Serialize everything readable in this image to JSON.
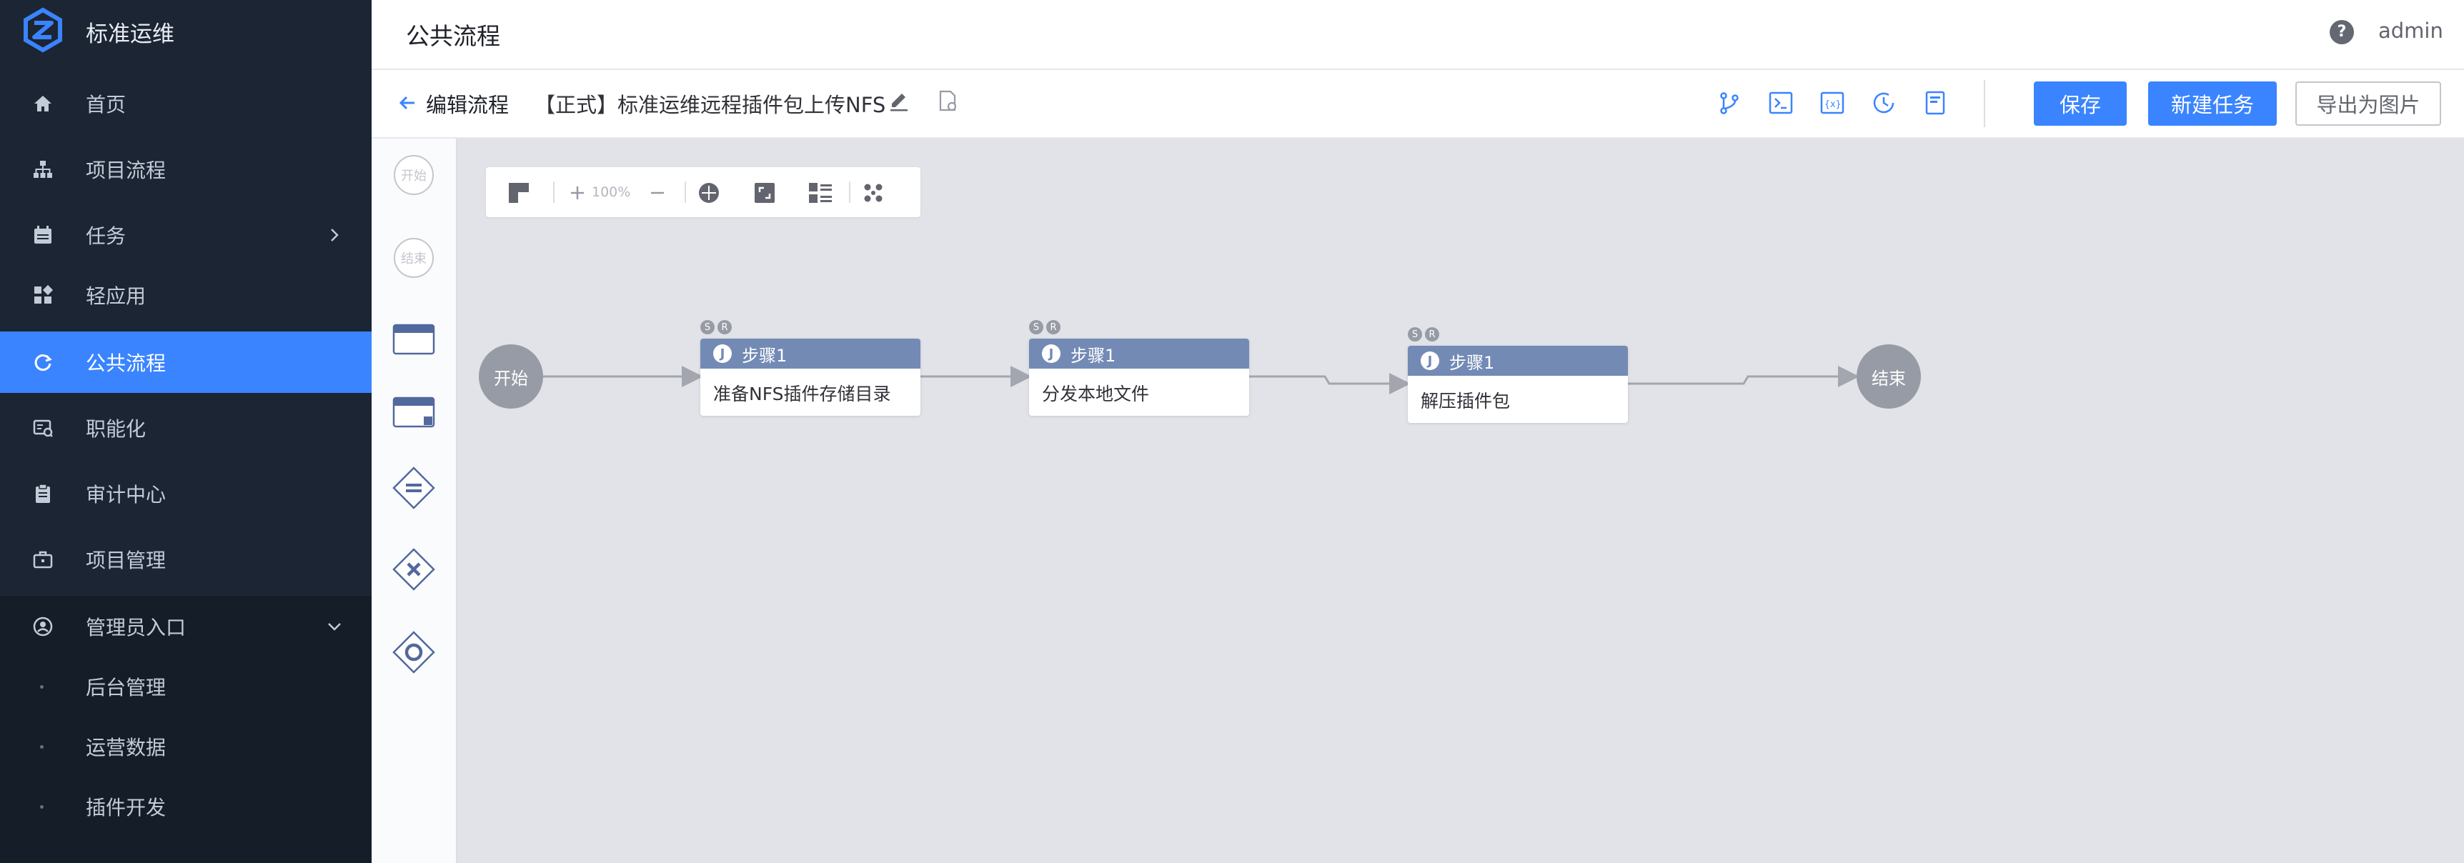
{
  "app": {
    "title": "标准运维"
  },
  "sidebar": {
    "items": [
      {
        "label": "首页",
        "icon": "home-icon"
      },
      {
        "label": "项目流程",
        "icon": "sitemap-icon"
      },
      {
        "label": "任务",
        "icon": "calendar-icon"
      },
      {
        "label": "轻应用",
        "icon": "apps-icon"
      },
      {
        "label": "公共流程",
        "icon": "refresh-icon",
        "active": true
      },
      {
        "label": "职能化",
        "icon": "function-icon"
      },
      {
        "label": "审计中心",
        "icon": "clipboard-icon"
      },
      {
        "label": "项目管理",
        "icon": "briefcase-icon"
      },
      {
        "label": "管理员入口",
        "icon": "user-circle-icon"
      }
    ],
    "admin_sub": [
      "后台管理",
      "运营数据",
      "插件开发"
    ]
  },
  "header": {
    "page_title": "公共流程",
    "user": "admin",
    "help": "?"
  },
  "subbar": {
    "back_label": "编辑流程",
    "flow_name": "【正式】标准运维远程插件包上传NFS",
    "buttons": {
      "save": "保存",
      "new_task": "新建任务",
      "export_image": "导出为图片"
    }
  },
  "palette": {
    "start": "开始",
    "end": "结束"
  },
  "zoombar": {
    "zoom": "100%"
  },
  "flow": {
    "start_label": "开始",
    "end_label": "结束",
    "nodes": [
      {
        "step": "步骤1",
        "name": "准备NFS插件存储目录",
        "badges": [
          "S",
          "R"
        ]
      },
      {
        "step": "步骤1",
        "name": "分发本地文件",
        "badges": [
          "S",
          "R"
        ]
      },
      {
        "step": "步骤1",
        "name": "解压插件包",
        "badges": [
          "S",
          "R"
        ]
      }
    ]
  },
  "colors": {
    "accent": "#3a84ff",
    "sidebar_bg": "#1c2533",
    "node_header": "#738ab5",
    "canvas_bg": "#e1e3e8"
  }
}
